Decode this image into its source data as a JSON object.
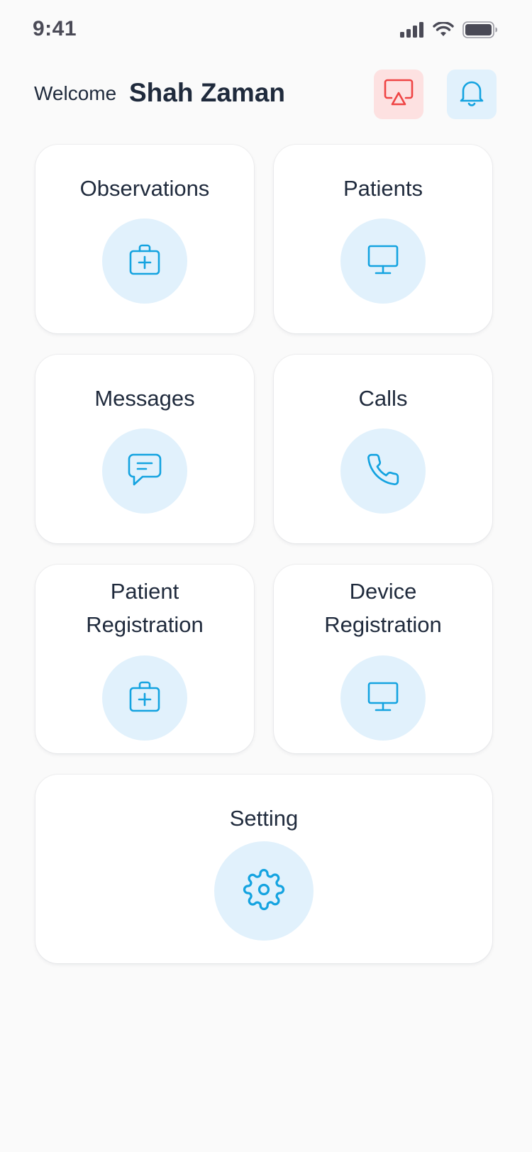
{
  "status_bar": {
    "time": "9:41",
    "icons": [
      "signal-icon",
      "wifi-icon",
      "battery-icon"
    ]
  },
  "header": {
    "welcome_label": "Welcome",
    "user_name": "Shah Zaman",
    "actions": [
      "cast-icon",
      "bell-icon"
    ]
  },
  "menu": {
    "items": [
      {
        "label": "Observations",
        "icon": "medical-bag-icon"
      },
      {
        "label": "Patients",
        "icon": "monitor-icon"
      },
      {
        "label": "Messages",
        "icon": "chat-bubble-icon"
      },
      {
        "label": "Calls",
        "icon": "phone-icon"
      },
      {
        "label": "Patient Registration",
        "icon": "medical-bag-icon"
      },
      {
        "label": "Device Registration",
        "icon": "monitor-icon"
      },
      {
        "label": "Setting",
        "icon": "gear-icon"
      }
    ]
  },
  "colors": {
    "accent": "#14a3e0",
    "accent_bg": "#e1f1fc",
    "alert": "#ef4444",
    "alert_bg": "#fde1e1",
    "text": "#1f2a3c",
    "background": "#fafafa"
  }
}
